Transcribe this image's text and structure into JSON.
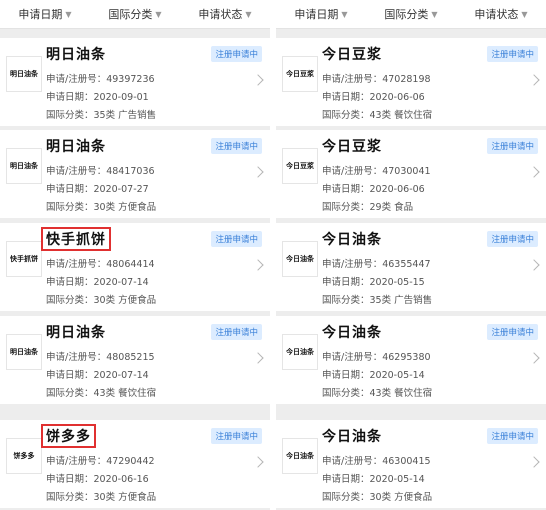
{
  "filters": [
    "申请日期",
    "国际分类",
    "申请状态"
  ],
  "left": [
    {
      "logo": "明日油条",
      "name": "明日油条",
      "highlight": false,
      "reg": "申请/注册号：49397236",
      "date": "申请日期：2020-09-01",
      "class": "国际分类：35类 广告销售",
      "status": "注册申请中"
    },
    {
      "logo": "明日油条",
      "name": "明日油条",
      "highlight": false,
      "reg": "申请/注册号：48417036",
      "date": "申请日期：2020-07-27",
      "class": "国际分类：30类 方便食品",
      "status": "注册申请中"
    },
    {
      "logo": "快手抓饼",
      "name": "快手抓饼",
      "highlight": true,
      "reg": "申请/注册号：48064414",
      "date": "申请日期：2020-07-14",
      "class": "国际分类：30类 方便食品",
      "status": "注册申请中"
    },
    {
      "logo": "明日油条",
      "name": "明日油条",
      "highlight": false,
      "reg": "申请/注册号：48085215",
      "date": "申请日期：2020-07-14",
      "class": "国际分类：43类 餐饮住宿",
      "status": "注册申请中"
    },
    {
      "logo": "饼多多",
      "name": "饼多多",
      "highlight": true,
      "reg": "申请/注册号：47290442",
      "date": "申请日期：2020-06-16",
      "class": "国际分类：30类 方便食品",
      "status": "注册申请中"
    }
  ],
  "right": [
    {
      "logo": "今日豆浆",
      "name": "今日豆浆",
      "highlight": false,
      "reg": "申请/注册号：47028198",
      "date": "申请日期：2020-06-06",
      "class": "国际分类：43类 餐饮住宿",
      "status": "注册申请中"
    },
    {
      "logo": "今日豆浆",
      "name": "今日豆浆",
      "highlight": false,
      "reg": "申请/注册号：47030041",
      "date": "申请日期：2020-06-06",
      "class": "国际分类：29类 食品",
      "status": "注册申请中"
    },
    {
      "logo": "今日油条",
      "name": "今日油条",
      "highlight": false,
      "reg": "申请/注册号：46355447",
      "date": "申请日期：2020-05-15",
      "class": "国际分类：35类 广告销售",
      "status": "注册申请中"
    },
    {
      "logo": "今日油条",
      "name": "今日油条",
      "highlight": false,
      "reg": "申请/注册号：46295380",
      "date": "申请日期：2020-05-14",
      "class": "国际分类：43类 餐饮住宿",
      "status": "注册申请中"
    },
    {
      "logo": "今日油条",
      "name": "今日油条",
      "highlight": false,
      "reg": "申请/注册号：46300415",
      "date": "申请日期：2020-05-14",
      "class": "国际分类：30类 方便食品",
      "status": "注册申请中"
    }
  ]
}
